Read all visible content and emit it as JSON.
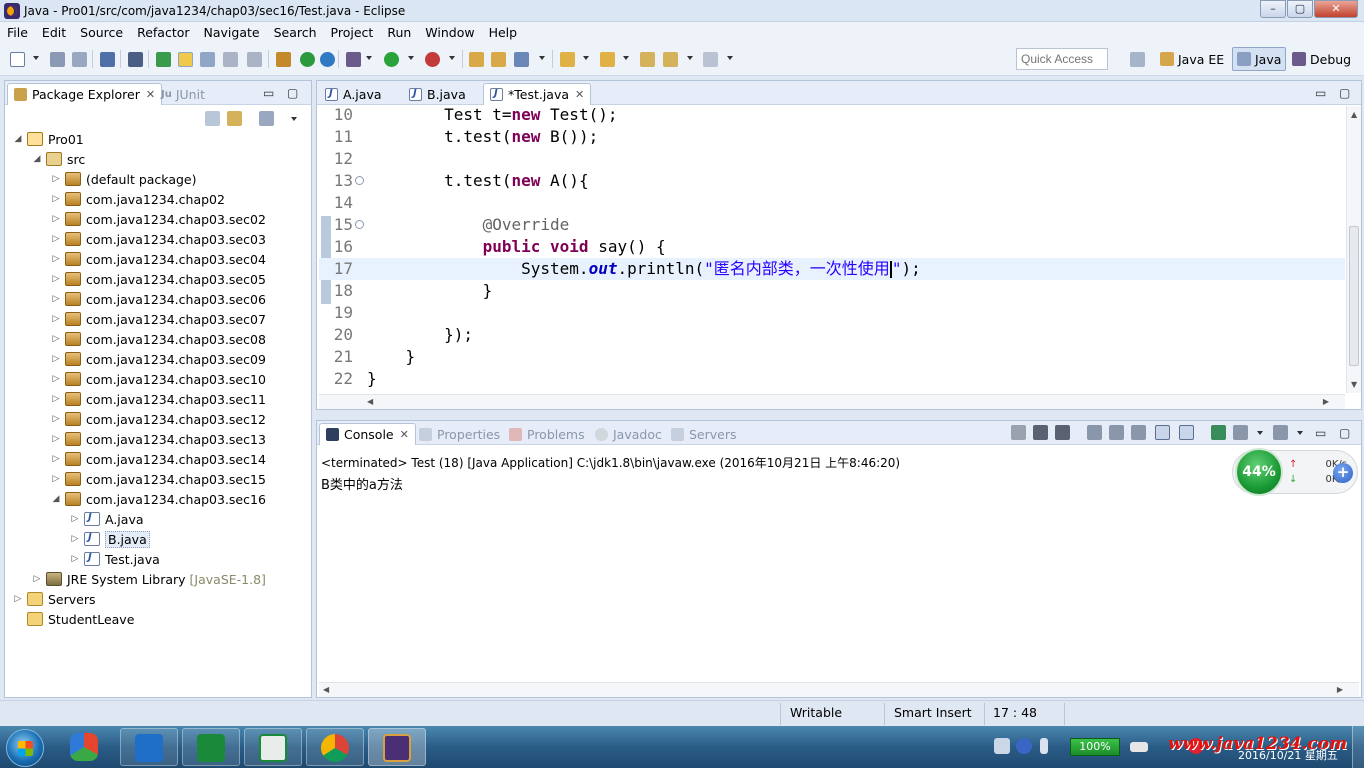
{
  "window": {
    "title": "Java - Pro01/src/com/java1234/chap03/sec16/Test.java - Eclipse",
    "buttons": [
      "–",
      "▢",
      "✕"
    ]
  },
  "menu": [
    "File",
    "Edit",
    "Source",
    "Refactor",
    "Navigate",
    "Search",
    "Project",
    "Run",
    "Window",
    "Help"
  ],
  "toolbar": {
    "quick_access_placeholder": "Quick Access",
    "perspectives": [
      {
        "label": "Java EE",
        "active": false
      },
      {
        "label": "Java",
        "active": true
      },
      {
        "label": "Debug",
        "active": false
      }
    ]
  },
  "package_explorer": {
    "tabs": [
      {
        "label": "Package Explorer",
        "close": "✕",
        "active": true
      },
      {
        "label": "JUnit",
        "prefix": "Ju",
        "active": false
      }
    ],
    "tree": [
      {
        "label": "Pro01",
        "toggle": "◢",
        "icon": "proj"
      },
      {
        "label": "src",
        "toggle": "◢",
        "icon": "srcf"
      },
      {
        "label": "(default package)",
        "toggle": "▷",
        "icon": "pkg"
      },
      {
        "label": "com.java1234.chap02",
        "toggle": "▷",
        "icon": "pkg"
      },
      {
        "label": "com.java1234.chap03.sec02",
        "toggle": "▷",
        "icon": "pkg"
      },
      {
        "label": "com.java1234.chap03.sec03",
        "toggle": "▷",
        "icon": "pkg"
      },
      {
        "label": "com.java1234.chap03.sec04",
        "toggle": "▷",
        "icon": "pkg"
      },
      {
        "label": "com.java1234.chap03.sec05",
        "toggle": "▷",
        "icon": "pkg"
      },
      {
        "label": "com.java1234.chap03.sec06",
        "toggle": "▷",
        "icon": "pkg"
      },
      {
        "label": "com.java1234.chap03.sec07",
        "toggle": "▷",
        "icon": "pkg"
      },
      {
        "label": "com.java1234.chap03.sec08",
        "toggle": "▷",
        "icon": "pkg"
      },
      {
        "label": "com.java1234.chap03.sec09",
        "toggle": "▷",
        "icon": "pkg"
      },
      {
        "label": "com.java1234.chap03.sec10",
        "toggle": "▷",
        "icon": "pkg"
      },
      {
        "label": "com.java1234.chap03.sec11",
        "toggle": "▷",
        "icon": "pkg"
      },
      {
        "label": "com.java1234.chap03.sec12",
        "toggle": "▷",
        "icon": "pkg"
      },
      {
        "label": "com.java1234.chap03.sec13",
        "toggle": "▷",
        "icon": "pkg"
      },
      {
        "label": "com.java1234.chap03.sec14",
        "toggle": "▷",
        "icon": "pkg"
      },
      {
        "label": "com.java1234.chap03.sec15",
        "toggle": "▷",
        "icon": "pkg"
      },
      {
        "label": "com.java1234.chap03.sec16",
        "toggle": "◢",
        "icon": "pkg"
      },
      {
        "label": "A.java",
        "toggle": "▷",
        "icon": "jfile"
      },
      {
        "label": "B.java",
        "toggle": "▷",
        "icon": "jfile",
        "selected": true
      },
      {
        "label": "Test.java",
        "toggle": "▷",
        "icon": "jfile"
      },
      {
        "label": "JRE System Library",
        "suffix": "[JavaSE-1.8]",
        "toggle": "▷",
        "icon": "lib"
      },
      {
        "label": "Servers",
        "toggle": "▷",
        "icon": "fold"
      },
      {
        "label": "StudentLeave",
        "toggle": "",
        "icon": "fold"
      }
    ]
  },
  "editor": {
    "tabs": [
      {
        "label": "A.java",
        "active": false
      },
      {
        "label": "B.java",
        "active": false
      },
      {
        "label": "*Test.java",
        "close": "✕",
        "active": true
      }
    ],
    "lines": [
      {
        "n": "10",
        "code": [
          [
            "",
            "        Test t="
          ],
          [
            "kw",
            "new"
          ],
          [
            "",
            " Test();"
          ]
        ]
      },
      {
        "n": "11",
        "code": [
          [
            "",
            "        t.test("
          ],
          [
            "kw",
            "new"
          ],
          [
            "",
            " B());"
          ]
        ]
      },
      {
        "n": "12",
        "code": []
      },
      {
        "n": "13",
        "fold": "⊖",
        "code": [
          [
            "",
            "        t.test("
          ],
          [
            "kw",
            "new"
          ],
          [
            "",
            " A(){"
          ]
        ]
      },
      {
        "n": "14",
        "code": []
      },
      {
        "n": "15",
        "fold": "⊖",
        "code": [
          [
            "",
            "            "
          ],
          [
            "an",
            "@Override"
          ]
        ]
      },
      {
        "n": "16",
        "code": [
          [
            "",
            "            "
          ],
          [
            "kw",
            "public"
          ],
          [
            "",
            " "
          ],
          [
            "kw",
            "void"
          ],
          [
            "",
            " say() {"
          ]
        ]
      },
      {
        "n": "17",
        "current": true,
        "code": [
          [
            "",
            "                System."
          ],
          [
            "fld",
            "out"
          ],
          [
            "",
            ".println("
          ],
          [
            "str",
            "\"匿名内部类，一次性使用"
          ],
          [
            "caret",
            ""
          ],
          [
            "str",
            "\""
          ],
          [
            "",
            ");"
          ]
        ]
      },
      {
        "n": "18",
        "code": [
          [
            "",
            "            }"
          ]
        ]
      },
      {
        "n": "19",
        "code": []
      },
      {
        "n": "20",
        "code": [
          [
            "",
            "        });"
          ]
        ]
      },
      {
        "n": "21",
        "code": [
          [
            "",
            "    }"
          ]
        ]
      },
      {
        "n": "22",
        "code": [
          [
            "",
            "}"
          ]
        ]
      }
    ]
  },
  "console": {
    "tabs": [
      {
        "label": "Console",
        "close": "✕",
        "active": true
      },
      {
        "label": "Properties",
        "active": false
      },
      {
        "label": "Problems",
        "active": false
      },
      {
        "label": "Javadoc",
        "active": false
      },
      {
        "label": "Servers",
        "active": false
      }
    ],
    "header": "<terminated> Test (18) [Java Application] C:\\jdk1.8\\bin\\javaw.exe (2016年10月21日 上午8:46:20)",
    "output": "B类中的a方法"
  },
  "net_widget": {
    "percent": "44%",
    "up": "0K/s",
    "down": "0K/s",
    "up_arrow": "↑",
    "down_arrow": "↓",
    "plus": "+"
  },
  "status": {
    "writable": "Writable",
    "insert_mode": "Smart Insert",
    "position": "17 : 48"
  },
  "taskbar": {
    "battery": "100%",
    "watermark": "www.java1234.com",
    "date": "2016/10/21 星期五"
  },
  "colors": {
    "keyword": "#7f0055",
    "string": "#2a00ff",
    "field": "#0000c0",
    "annotation": "#646464",
    "current_line": "#e8f2fe"
  }
}
